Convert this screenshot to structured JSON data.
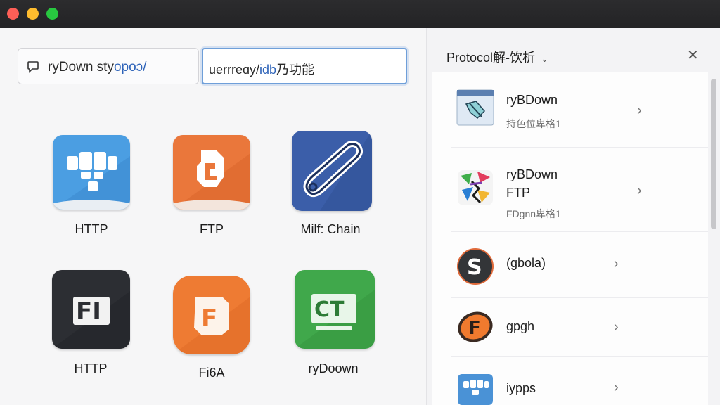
{
  "window": {
    "controls": [
      "close",
      "minimize",
      "zoom"
    ],
    "colors": {
      "close": "#fe5f57",
      "minimize": "#febc2e",
      "zoom": "#28c840"
    }
  },
  "search": {
    "text": "ryDown styopoo/ uerrreay/idb乃功能",
    "text_black": "ryDown sty",
    "text_blue": "opoo/",
    "text_rest": "uerrreay/idb乃功能",
    "left_text": "ryDown sty",
    "left_blue": "opoɔ/ "
  },
  "input": {
    "text_a": "uerrreɑy/",
    "text_b": "idb",
    "text_c": "乃功能"
  },
  "tiles": [
    {
      "label": "HTTP",
      "icon": "http-blocks-icon",
      "color": "#4a9be0"
    },
    {
      "label": "FTP",
      "icon": "ftp-gear-icon",
      "color": "#e8753a"
    },
    {
      "label": "Milf: Chain",
      "icon": "chain-link-icon",
      "color": "#3b5ea8"
    },
    {
      "label": "HTTP",
      "icon": "fi-box-icon",
      "color": "#2b2d31"
    },
    {
      "label": "Fi6A",
      "icon": "f-box-icon",
      "color": "#ec7a33"
    },
    {
      "label": "ryDoown",
      "icon": "ct-box-icon",
      "color": "#3fa84a"
    }
  ],
  "panel": {
    "title": "Protocol解-饮析",
    "items": [
      {
        "title": "ryBDown",
        "sub": "持色位卑格1",
        "icon": "browser-window-icon"
      },
      {
        "title": "ryBDown",
        "title2": "FTP",
        "sub": "FDgnn卑格1",
        "icon": "colorful-splash-icon"
      },
      {
        "title": "(gbola)",
        "icon": "s-circle-icon"
      },
      {
        "title": "gpgh",
        "icon": "f-circle-icon"
      },
      {
        "title": "iypps",
        "icon": "blue-blocks-icon"
      }
    ]
  }
}
